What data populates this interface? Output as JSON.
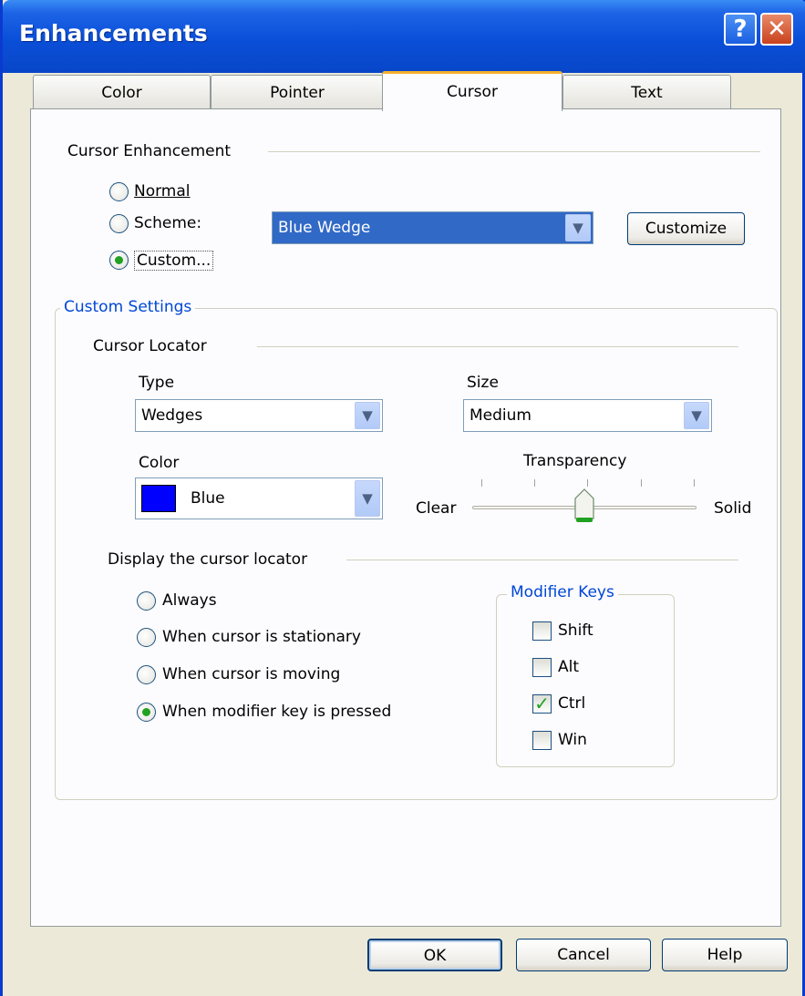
{
  "window": {
    "title": "Enhancements",
    "help_glyph": "?",
    "close_glyph": "✕"
  },
  "tabs": [
    {
      "label": "Color"
    },
    {
      "label": "Pointer"
    },
    {
      "label": "Cursor"
    },
    {
      "label": "Text"
    }
  ],
  "cursor_enhancement": {
    "heading": "Cursor Enhancement",
    "options": [
      {
        "label": "Normal",
        "selected": false
      },
      {
        "label": "Scheme:",
        "selected": false
      },
      {
        "label": "Custom...",
        "selected": true
      }
    ],
    "scheme_value": "Blue Wedge",
    "customize_label": "Customize"
  },
  "custom_settings": {
    "legend": "Custom Settings",
    "cursor_locator": {
      "heading": "Cursor Locator",
      "type_label": "Type",
      "type_value": "Wedges",
      "size_label": "Size",
      "size_value": "Medium",
      "color_label": "Color",
      "color_value": "Blue",
      "color_swatch": "#0000ff",
      "transparency_label": "Transparency",
      "transparency_min_label": "Clear",
      "transparency_max_label": "Solid",
      "transparency_level": 0.5
    },
    "display": {
      "heading": "Display the cursor locator",
      "options": [
        {
          "label": "Always",
          "selected": false
        },
        {
          "label": "When cursor is stationary",
          "selected": false
        },
        {
          "label": "When cursor is moving",
          "selected": false
        },
        {
          "label": "When modifier key is pressed",
          "selected": true
        }
      ]
    },
    "modifier_keys": {
      "legend": "Modifier Keys",
      "keys": [
        {
          "label": "Shift",
          "checked": false
        },
        {
          "label": "Alt",
          "checked": false
        },
        {
          "label": "Ctrl",
          "checked": true
        },
        {
          "label": "Win",
          "checked": false
        }
      ]
    }
  },
  "footer": {
    "ok_label": "OK",
    "cancel_label": "Cancel",
    "help_label": "Help"
  },
  "colors": {
    "title_bar": "#0a4fd8",
    "accent": "#3169c6",
    "selected_tab": "#f5b030",
    "group_legend": "#0046d5",
    "check": "#21a121"
  },
  "check_glyph": "✓",
  "dropdown_glyph": "▼"
}
